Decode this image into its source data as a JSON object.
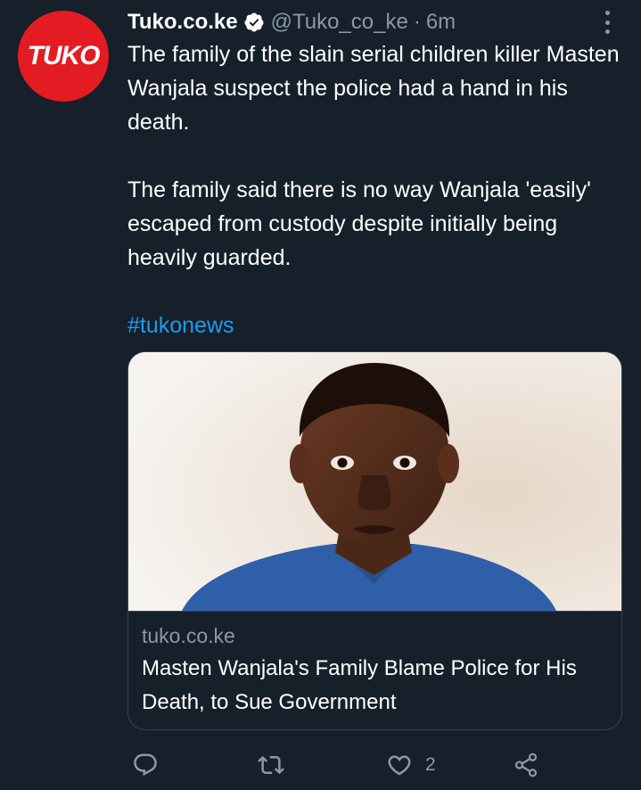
{
  "avatar": {
    "text": "TUKO",
    "color": "#e31b23"
  },
  "author": {
    "display_name": "Tuko.co.ke",
    "verified_icon": "verified-badge-icon",
    "handle": "@Tuko_co_ke",
    "separator": "·",
    "time": "6m"
  },
  "tweet": {
    "paragraph1": "The family of the slain serial children killer Masten Wanjala suspect the police had a hand in his death.",
    "paragraph2": "The family said there is no way Wanjala 'easily' escaped from custody despite initially being heavily guarded.",
    "hashtag": "#tukonews"
  },
  "card": {
    "image": "photo of a young man in a blue shirt",
    "domain": "tuko.co.ke",
    "title": "Masten Wanjala's Family Blame Police for His Death, to Sue Government"
  },
  "actions": {
    "reply_icon": "reply-icon",
    "retweet_icon": "retweet-icon",
    "like_icon": "heart-icon",
    "like_count": "2",
    "share_icon": "share-icon"
  },
  "colors": {
    "background": "#15202b",
    "secondary_text": "#8b98a5",
    "link": "#1d9bf0",
    "border": "#38444d"
  }
}
